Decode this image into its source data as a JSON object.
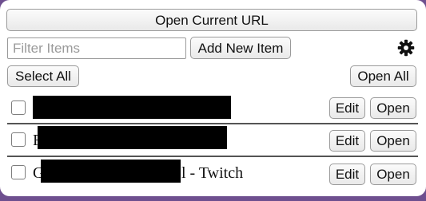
{
  "toolbar": {
    "open_current_url_label": "Open Current URL",
    "filter_placeholder": "Filter Items",
    "filter_value": "",
    "add_new_item_label": "Add New Item",
    "settings_icon": "gear-icon",
    "select_all_label": "Select All",
    "open_all_label": "Open All"
  },
  "items": [
    {
      "title_prefix": "",
      "title_suffix": "",
      "redacted": true,
      "edit_label": "Edit",
      "open_label": "Open"
    },
    {
      "title_prefix": "F",
      "title_suffix": "",
      "redacted": true,
      "edit_label": "Edit",
      "open_label": "Open"
    },
    {
      "title_prefix": "G",
      "title_suffix": "l - Twitch",
      "redacted": true,
      "edit_label": "Edit",
      "open_label": "Open"
    }
  ],
  "colors": {
    "background_purple": "#6e4f8f",
    "popup_bg": "#ffffff",
    "redaction": "#000000"
  }
}
